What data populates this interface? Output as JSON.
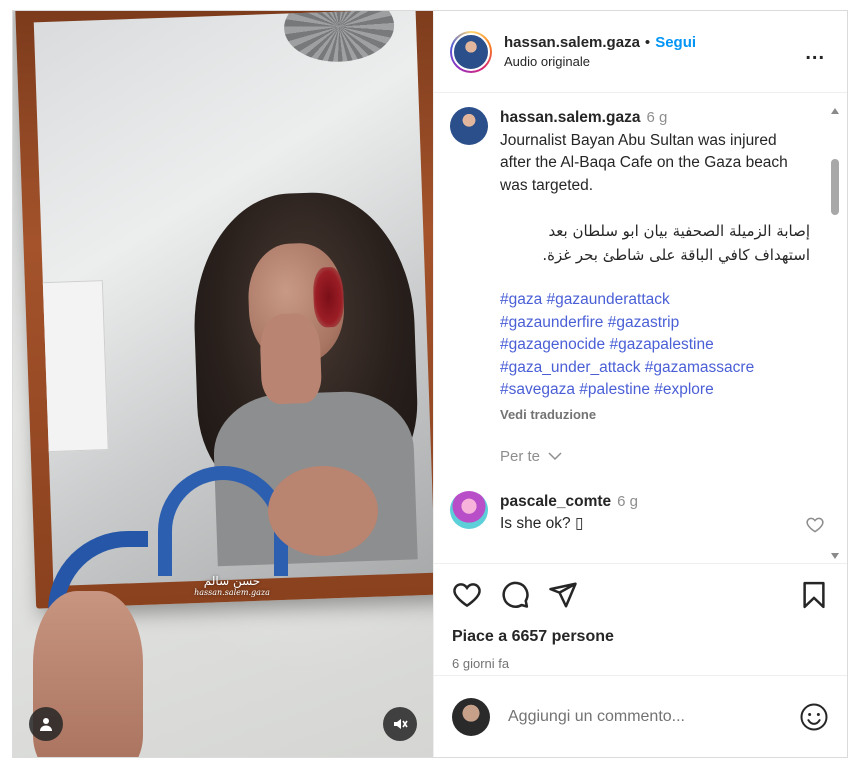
{
  "post": {
    "username": "hassan.salem.gaza",
    "follow_label": "Segui",
    "dot": "•",
    "audio": "Audio originale",
    "more": "..."
  },
  "media": {
    "watermark_line1": "حسن سالم",
    "watermark_line2": "hassan.salem.gaza",
    "profile_icon": "person-icon",
    "mute_icon": "speaker-muted-icon"
  },
  "caption": {
    "username": "hassan.salem.gaza",
    "time": "6 g",
    "english": "Journalist Bayan Abu Sultan was injured after the Al-Baqa Cafe on the Gaza beach was targeted.",
    "arabic": "إصابة الزميلة الصحفية بيان ابو سلطان بعد استهداف كافي الباقة على شاطئ بحر غزة.",
    "hashtag_lines": [
      "#gaza #gazaunderattack",
      "#gazaunderfire #gazastrip",
      "#gazagenocide #gazapalestine",
      "#gaza_under_attack #gazamassacre",
      "#savegaza #palestine #explore"
    ],
    "translate_label": "Vedi traduzione",
    "for_you_label": "Per te"
  },
  "comment": {
    "username": "pascale_comte",
    "time": "6 g",
    "text": "Is she ok? ▯"
  },
  "actions": {
    "likes": "Piace a 6657 persone",
    "date": "6 giorni fa"
  },
  "composer": {
    "placeholder": "Aggiungi un commento..."
  },
  "colors": {
    "follow_blue": "#0095f6",
    "hashtag_blue": "#4a5fd6",
    "hose_blue": "#2556a8",
    "frame_wood": "#a4532b"
  }
}
